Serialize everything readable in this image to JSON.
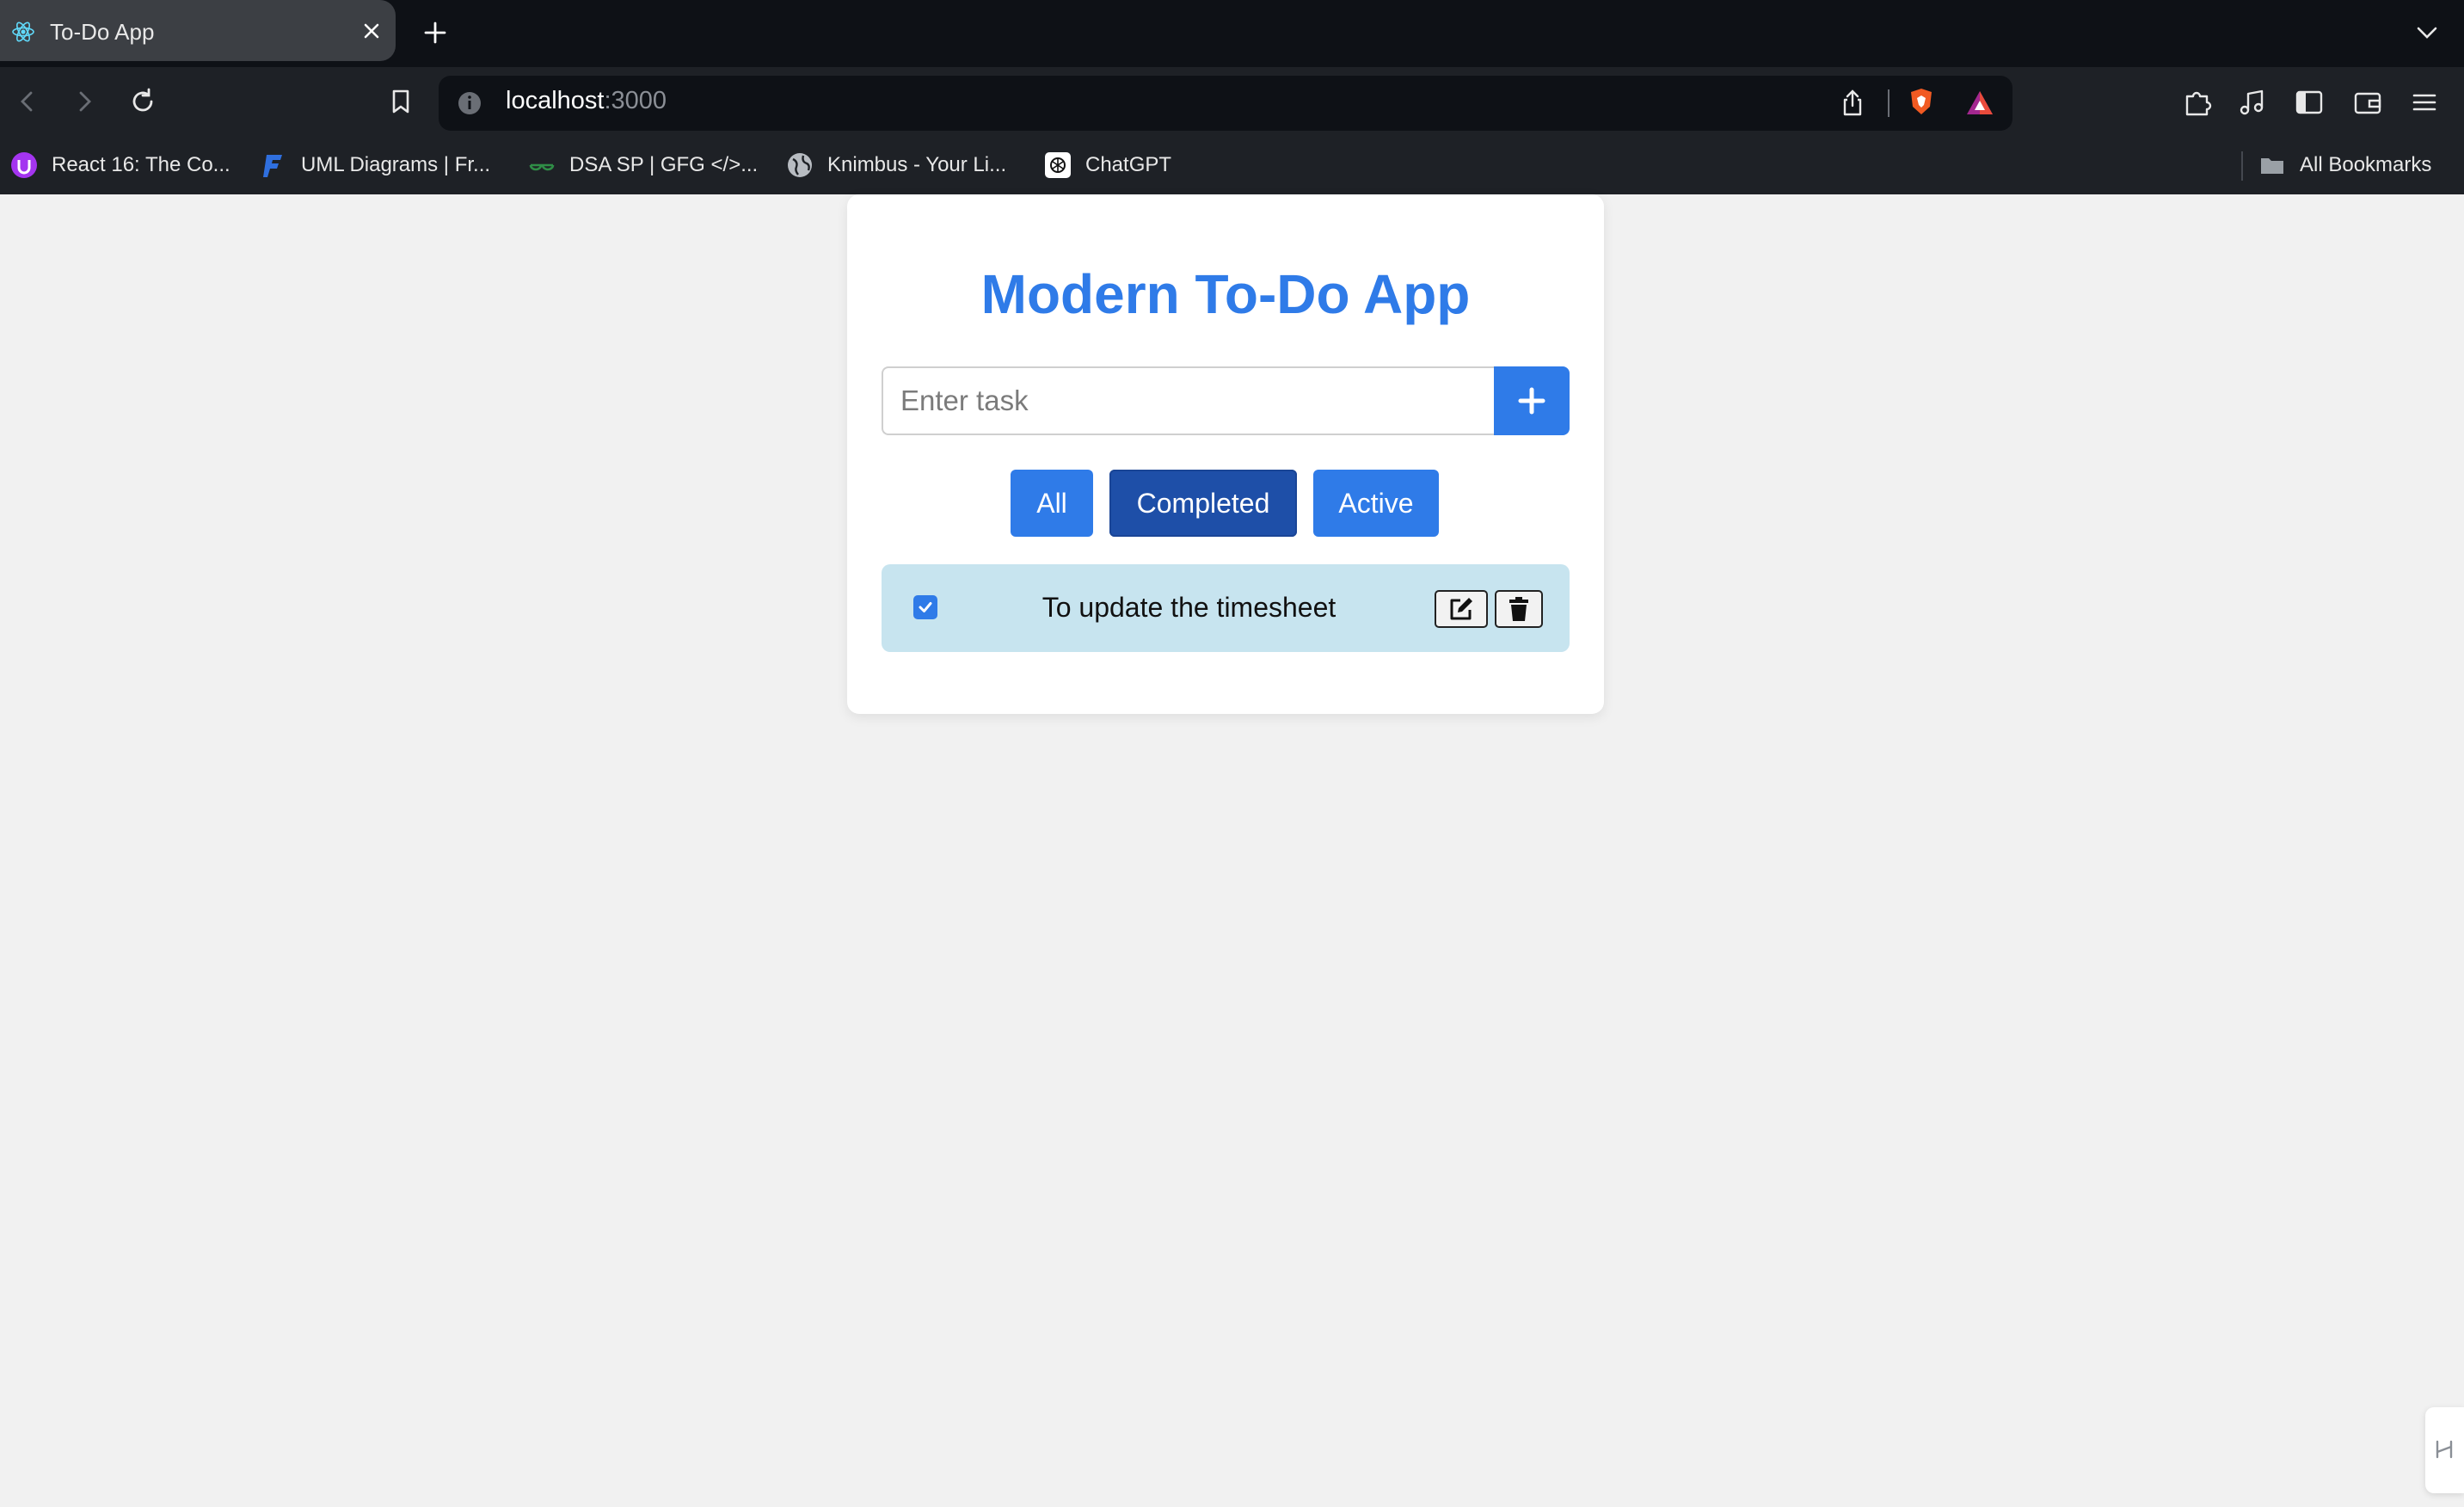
{
  "browser": {
    "tab_title": "To-Do App",
    "url_host": "localhost",
    "url_port": ":3000",
    "bookmarks": [
      {
        "label": "React 16: The Co...",
        "icon": "udemy-icon"
      },
      {
        "label": "UML Diagrams | Fr...",
        "icon": "uml-icon"
      },
      {
        "label": "DSA SP | GFG </>...",
        "icon": "gfg-icon"
      },
      {
        "label": "Knimbus - Your Li...",
        "icon": "globe-icon"
      },
      {
        "label": "ChatGPT",
        "icon": "chatgpt-icon"
      }
    ],
    "all_bookmarks_label": "All Bookmarks"
  },
  "app": {
    "title": "Modern To-Do App",
    "input_placeholder": "Enter task",
    "input_value": "",
    "add_button_icon": "plus-icon",
    "filters": [
      {
        "label": "All",
        "active": false
      },
      {
        "label": "Completed",
        "active": true
      },
      {
        "label": "Active",
        "active": false
      }
    ],
    "tasks": [
      {
        "text": "To update the timesheet",
        "completed": true
      }
    ]
  },
  "colors": {
    "accent": "#2f7be8",
    "accent_active": "#1e4fa8",
    "task_bg": "#c7e4ef",
    "page_bg": "#f1f1f1"
  }
}
